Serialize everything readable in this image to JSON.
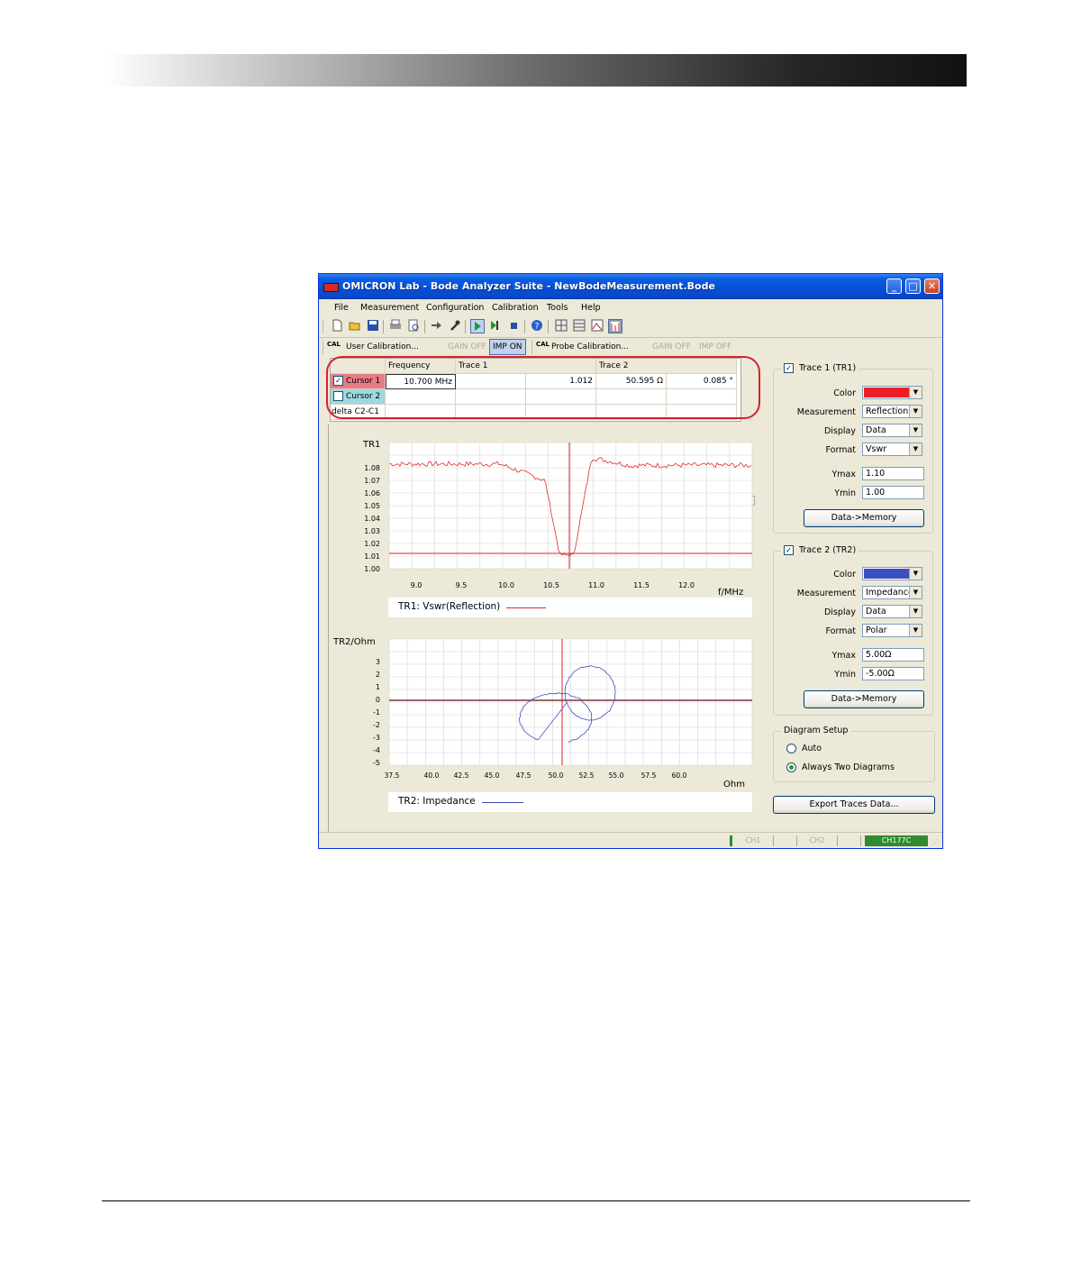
{
  "window": {
    "title": "OMICRON Lab - Bode Analyzer Suite - NewBodeMeasurement.Bode",
    "controls": {
      "minimize": "_",
      "maximize": "□",
      "close": "✕"
    }
  },
  "menu": [
    "File",
    "Measurement",
    "Configuration",
    "Calibration",
    "Tools",
    "Help"
  ],
  "toolbar_icons": [
    "new-icon",
    "open-icon",
    "save-icon",
    "print-icon",
    "print-preview-icon",
    "connect-icon",
    "wrench-icon",
    "single-sweep-icon",
    "continuous-sweep-icon",
    "stop-icon",
    "help-icon",
    "tile-icon-1",
    "tile-icon-2",
    "chart-icon",
    "frequency-sweep-icon"
  ],
  "calibration_bar": {
    "user_calibration": "User Calibration...",
    "user_gain_off": "GAIN OFF",
    "user_imp_on": "IMP ON",
    "probe_calibration": "Probe Calibration...",
    "probe_gain_off": "GAIN OFF",
    "probe_imp_off": "IMP OFF",
    "cal_icon_text": "CAL"
  },
  "cursor_table": {
    "headers": {
      "frequency": "Frequency",
      "trace1": "Trace 1",
      "trace2": "Trace 2"
    },
    "rows": {
      "cursor1": {
        "label": "Cursor 1",
        "checked": "✓",
        "frequency": "10.700 MHz",
        "t1a": "",
        "t1b": "1.012",
        "t2a": "50.595 Ω",
        "t2b": "0.085 °"
      },
      "cursor2": {
        "label": "Cursor 2",
        "checked": ""
      },
      "delta": {
        "label": "delta C2-C1"
      }
    }
  },
  "tr1_chart": {
    "y_label": "TR1",
    "x_unit": "f/MHz",
    "y_ticks": [
      "1.08",
      "1.07",
      "1.06",
      "1.05",
      "1.04",
      "1.03",
      "1.02",
      "1.01",
      "1.00"
    ],
    "x_ticks": [
      "9.0",
      "9.5",
      "10.0",
      "10.5",
      "11.0",
      "11.5",
      "12.0"
    ],
    "legend": "TR1: Vswr(Reflection)",
    "color": "#e02a2a"
  },
  "tr2_chart": {
    "y_label": "TR2/Ohm",
    "x_unit": "Ohm",
    "y_ticks": [
      "3",
      "2",
      "1",
      "0",
      "-1",
      "-2",
      "-3",
      "-4",
      "-5"
    ],
    "x_ticks": [
      "37.5",
      "40.0",
      "42.5",
      "45.0",
      "47.5",
      "50.0",
      "52.5",
      "55.0",
      "57.5",
      "60.0"
    ],
    "legend": "TR2: Impedance",
    "color": "#3a4fb8"
  },
  "trace1_panel": {
    "title": "Trace 1 (TR1)",
    "checked": "✓",
    "color_label": "Color",
    "color": "#ee1c24",
    "measurement_label": "Measurement",
    "measurement": "Reflection",
    "display_label": "Display",
    "display": "Data",
    "format_label": "Format",
    "format": "Vswr",
    "ymax_label": "Ymax",
    "ymax": "1.10",
    "ymin_label": "Ymin",
    "ymin": "1.00",
    "memory_button": "Data->Memory"
  },
  "trace2_panel": {
    "title": "Trace 2 (TR2)",
    "checked": "✓",
    "color_label": "Color",
    "color": "#3a4fc0",
    "measurement_label": "Measurement",
    "measurement": "Impedance",
    "display_label": "Display",
    "display": "Data",
    "format_label": "Format",
    "format": "Polar",
    "ymax_label": "Ymax",
    "ymax": "5.00Ω",
    "ymin_label": "Ymin",
    "ymin": "-5.00Ω",
    "memory_button": "Data->Memory"
  },
  "diagram_setup": {
    "title": "Diagram Setup",
    "auto": "Auto",
    "always_two": "Always Two Diagrams"
  },
  "export_button": "Export Traces Data...",
  "status_bar": {
    "ch1": "CH1",
    "ch2": "CH2",
    "device": "CH177C"
  }
}
